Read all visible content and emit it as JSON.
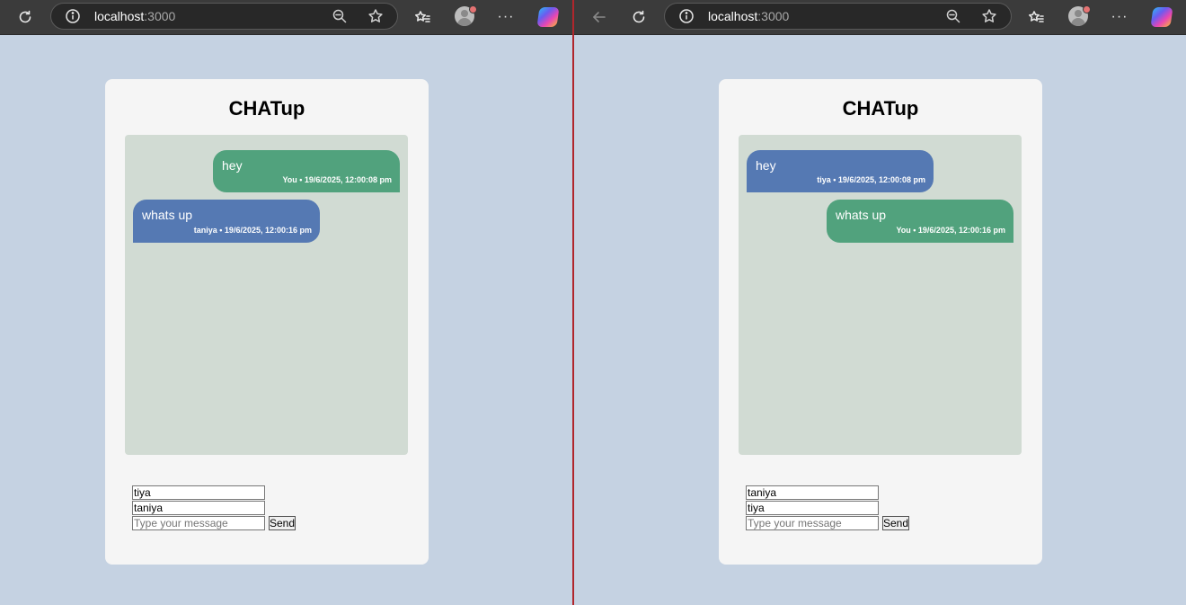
{
  "browser": {
    "url_host": "localhost",
    "url_port": ":3000"
  },
  "app": {
    "title": "CHATup"
  },
  "left_window": {
    "messages": [
      {
        "text": "hey",
        "meta": "You • 19/6/2025, 12:00:08 pm",
        "direction": "out"
      },
      {
        "text": "whats up",
        "meta": "taniya • 19/6/2025, 12:00:16 pm",
        "direction": "in"
      }
    ],
    "form": {
      "username_value": "tiya",
      "recipient_value": "taniya",
      "message_placeholder": "Type your message",
      "message_value": "",
      "send_label": "Send"
    }
  },
  "right_window": {
    "messages": [
      {
        "text": "hey",
        "meta": "tiya • 19/6/2025, 12:00:08 pm",
        "direction": "in"
      },
      {
        "text": "whats up",
        "meta": "You • 19/6/2025, 12:00:16 pm",
        "direction": "out"
      }
    ],
    "form": {
      "username_value": "taniya",
      "recipient_value": "tiya",
      "message_placeholder": "Type your message",
      "message_value": "",
      "send_label": "Send"
    }
  },
  "colors": {
    "page_background": "#c5d2e2",
    "card": "#f5f5f5",
    "chat_area": "#d1dbd3",
    "outgoing_bubble": "#51a27d",
    "incoming_bubble": "#5579b3",
    "browser_toolbar": "#3b3b3b",
    "divider": "#b0262c"
  },
  "icons": {
    "toolbar": [
      "back-arrow-icon",
      "refresh-icon",
      "site-info-icon",
      "zoom-out-icon",
      "star-icon",
      "favorites-icon",
      "profile-avatar-icon",
      "more-icon",
      "copilot-icon"
    ]
  }
}
